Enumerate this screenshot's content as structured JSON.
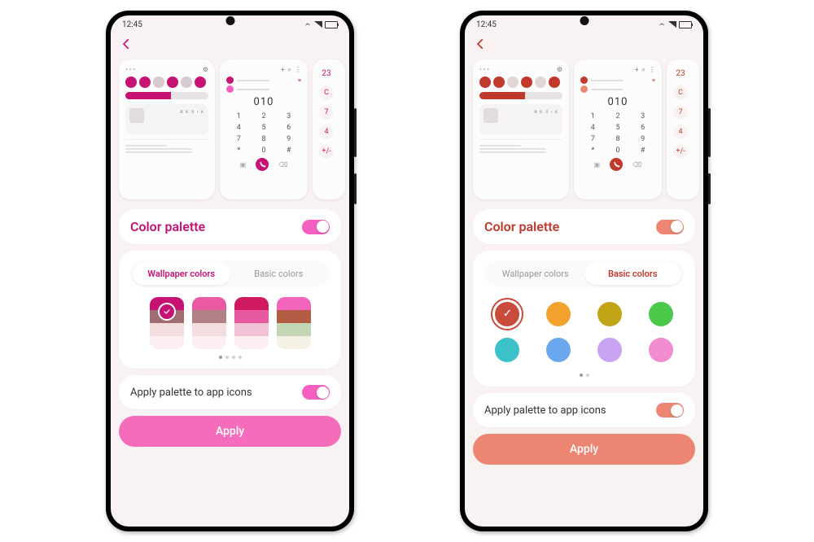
{
  "status_time": "12:45",
  "preview_dial_number": "010",
  "preview_dial_keys": [
    "1",
    "2",
    "3",
    "4",
    "5",
    "6",
    "7",
    "8",
    "9",
    "*",
    "0",
    "#"
  ],
  "preview_calc_keys": [
    "23",
    "C",
    "7",
    "4",
    "+/-"
  ],
  "color_palette_label": "Color palette",
  "tab_wallpaper": "Wallpaper colors",
  "tab_basic": "Basic colors",
  "apply_icons_label": "Apply palette to app icons",
  "apply_label": "Apply",
  "phones": {
    "pink": {
      "accent": "#c51273",
      "accent_light": "#f55fc0",
      "bg_tint": "#f8f2f4",
      "apply_btn": "#f56cbb",
      "active_tab": "wallpaper",
      "pager_count": 4,
      "pager_active": 0,
      "quick_toggle_on": [
        "#c51273",
        "#c51273",
        "#d8c8cf",
        "#c51273",
        "#d8c8cf",
        "#c51273"
      ],
      "slider_fill": "#c51273",
      "swatches": [
        {
          "bands": [
            "#c51273",
            "#a26d72",
            "#f2dede",
            "#fceef1"
          ],
          "selected": true
        },
        {
          "bands": [
            "#e95aa0",
            "#b18187",
            "#f2dede",
            "#fceef1"
          ],
          "selected": false
        },
        {
          "bands": [
            "#d01a60",
            "#e85aa0",
            "#f2c3d7",
            "#fceef1"
          ],
          "selected": false
        },
        {
          "bands": [
            "#f365bd",
            "#b25c43",
            "#c3d7b4",
            "#f6f1e7"
          ],
          "selected": false
        }
      ]
    },
    "red": {
      "accent": "#c0392b",
      "accent_light": "#ec8673",
      "bg_tint": "#f8f3f2",
      "apply_btn": "#ec8673",
      "active_tab": "basic",
      "pager_count": 2,
      "pager_active": 0,
      "quick_toggle_on": [
        "#c0392b",
        "#c0392b",
        "#e0d6d3",
        "#c0392b",
        "#e0d6d3",
        "#c0392b"
      ],
      "slider_fill": "#c0392b",
      "dots": [
        {
          "c": "#c94b3b",
          "selected": true
        },
        {
          "c": "#f3a22e",
          "selected": false
        },
        {
          "c": "#c2a516",
          "selected": false
        },
        {
          "c": "#4ac94b",
          "selected": false
        },
        {
          "c": "#3bc2c9",
          "selected": false
        },
        {
          "c": "#6ba8ef",
          "selected": false
        },
        {
          "c": "#c9a3f4",
          "selected": false
        },
        {
          "c": "#f38bd0",
          "selected": false
        }
      ]
    }
  }
}
